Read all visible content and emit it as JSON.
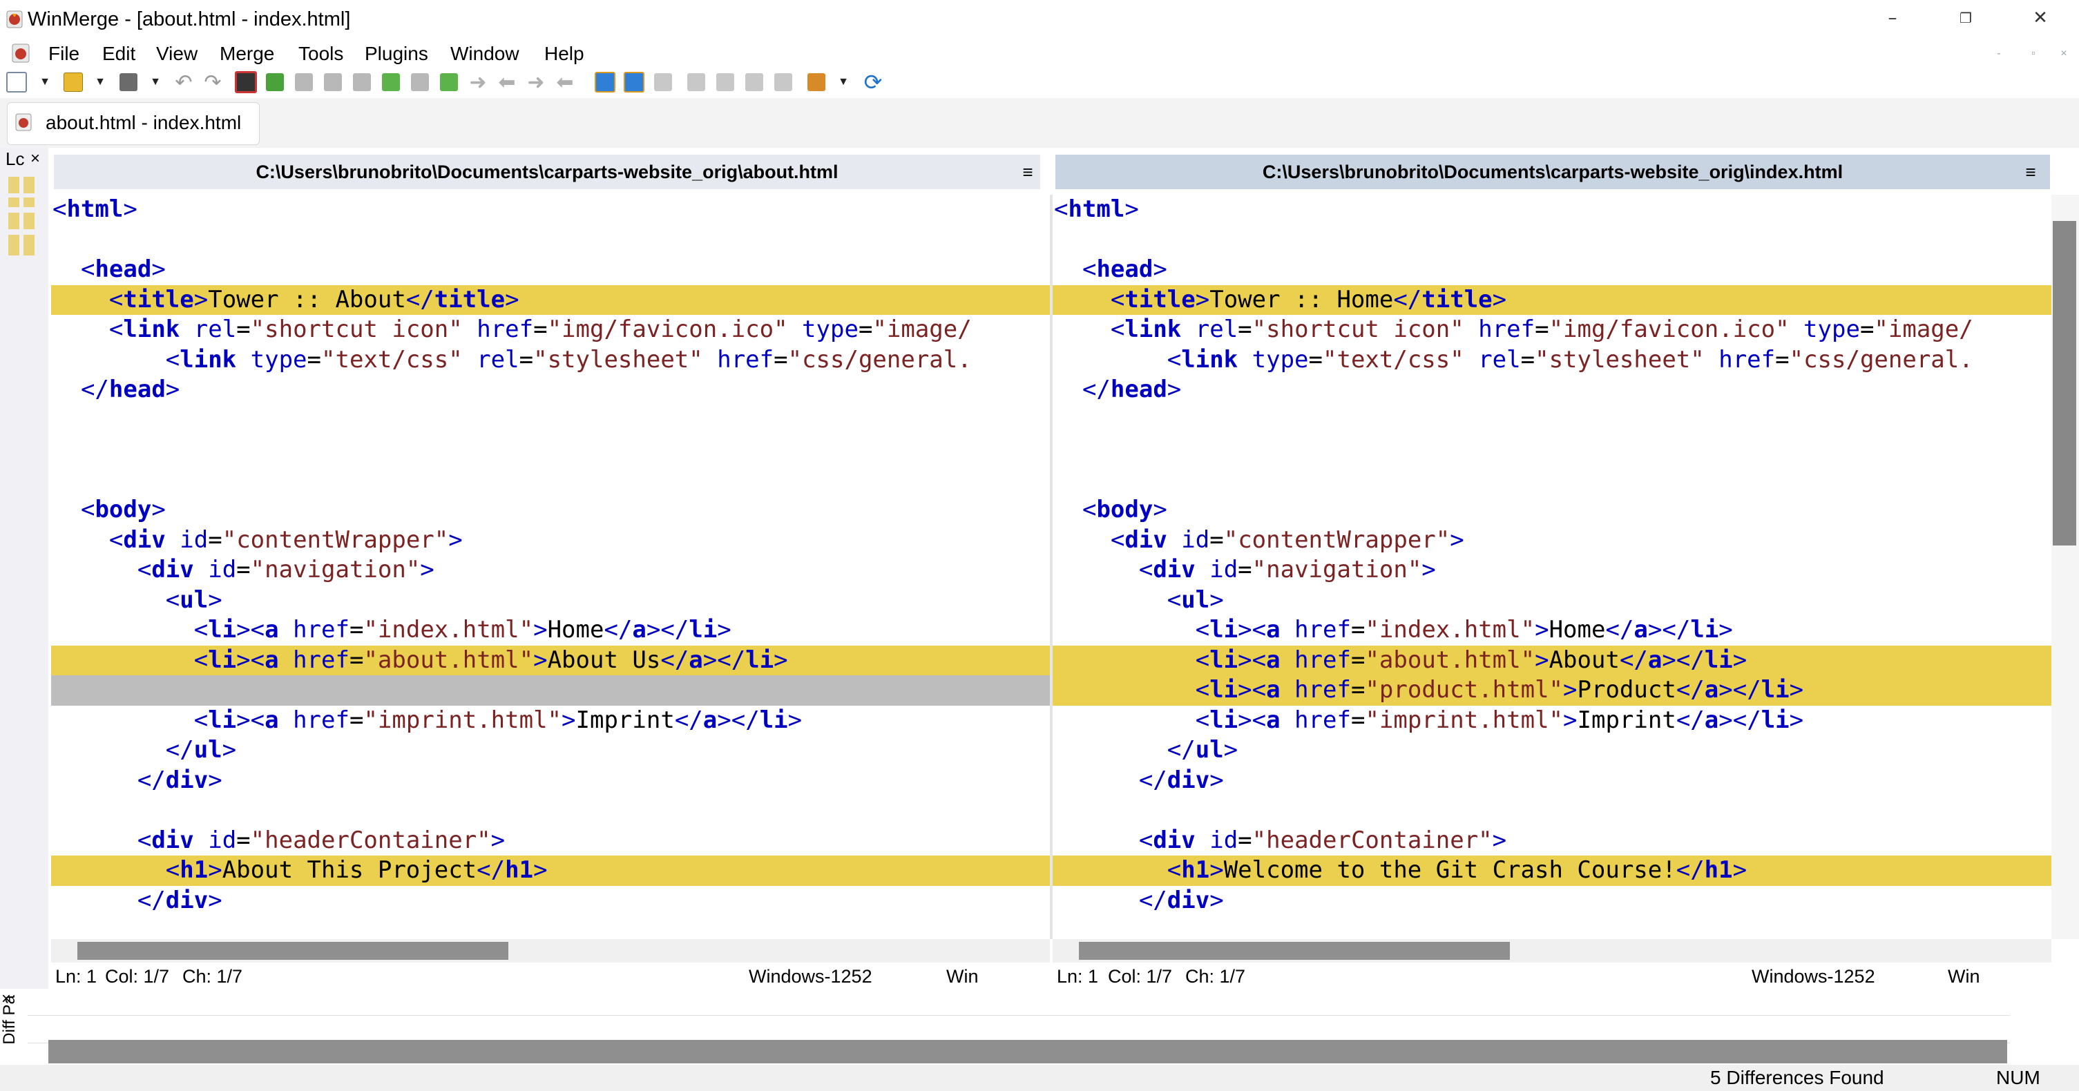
{
  "window": {
    "title": "WinMerge - [about.html - index.html]",
    "minimize_glyph": "–",
    "restore_glyph": "❐",
    "close_glyph": "✕"
  },
  "menu": [
    "File",
    "Edit",
    "View",
    "Merge",
    "Tools",
    "Plugins",
    "Window",
    "Help"
  ],
  "mdi_controls": [
    "-",
    "▫",
    "×"
  ],
  "toolbar_icons": [
    "new-icon",
    "open-folder-icon",
    "save-icon",
    "undo-icon",
    "redo-icon",
    "filter-icon",
    "next-diff-icon",
    "prev-diff-icon",
    "first-diff-icon",
    "last-diff-icon",
    "current-diff-icon",
    "next-conflict-icon",
    "prev-conflict-icon",
    "copy-right-icon",
    "copy-left-icon",
    "copy-right-advance-icon",
    "copy-left-advance-icon",
    "copy-all-right-icon",
    "copy-all-left-icon",
    "merge-icon",
    "compare-icon",
    "first-file-icon",
    "prev-file-icon",
    "next-file-icon",
    "last-file-icon",
    "options-icon",
    "refresh-icon"
  ],
  "tab": {
    "label": "about.html - index.html"
  },
  "location_pane": {
    "title": "Lc",
    "close": "×"
  },
  "left": {
    "path": "C:\\Users\\brunobrito\\Documents\\carparts-website_orig\\about.html",
    "menu_glyph": "≡",
    "status": {
      "ln": "Ln: 1",
      "col": "Col: 1/7",
      "ch": "Ch: 1/7",
      "encoding": "Windows-1252",
      "eol": "Win"
    }
  },
  "right": {
    "path": "C:\\Users\\brunobrito\\Documents\\carparts-website_orig\\index.html",
    "menu_glyph": "≡",
    "status": {
      "ln": "Ln: 1",
      "col": "Col: 1/7",
      "ch": "Ch: 1/7",
      "encoding": "Windows-1252",
      "eol": "Win"
    }
  },
  "code_left": [
    "<html>",
    "",
    "  <head>",
    "    <title>Tower :: About</title>",
    "    <link rel=\"shortcut icon\" href=\"img/favicon.ico\" type=\"image/",
    "        <link type=\"text/css\" rel=\"stylesheet\" href=\"css/general.",
    "  </head>",
    "",
    "",
    "",
    "  <body>",
    "    <div id=\"contentWrapper\">",
    "      <div id=\"navigation\">",
    "        <ul>",
    "          <li><a href=\"index.html\">Home</a></li>",
    "          <li><a href=\"about.html\">About Us</a></li>",
    "",
    "          <li><a href=\"imprint.html\">Imprint</a></li>",
    "        </ul>",
    "      </div>",
    "",
    "      <div id=\"headerContainer\">",
    "        <h1>About This Project</h1>",
    "      </div>"
  ],
  "code_right": [
    "<html>",
    "",
    "  <head>",
    "    <title>Tower :: Home</title>",
    "    <link rel=\"shortcut icon\" href=\"img/favicon.ico\" type=\"image/",
    "        <link type=\"text/css\" rel=\"stylesheet\" href=\"css/general.",
    "  </head>",
    "",
    "",
    "",
    "  <body>",
    "    <div id=\"contentWrapper\">",
    "      <div id=\"navigation\">",
    "        <ul>",
    "          <li><a href=\"index.html\">Home</a></li>",
    "          <li><a href=\"about.html\">About</a></li>",
    "          <li><a href=\"product.html\">Product</a></li>",
    "          <li><a href=\"imprint.html\">Imprint</a></li>",
    "        </ul>",
    "      </div>",
    "",
    "      <div id=\"headerContainer\">",
    "        <h1>Welcome to the Git Crash Course!</h1>",
    "      </div>"
  ],
  "diff_pane": {
    "title": "Diff Pa",
    "close": "×"
  },
  "statusbar": {
    "differences": "5 Differences Found",
    "num": "NUM"
  },
  "colors": {
    "diff_line": "#ead04e",
    "diff_word": "#f7ecbc",
    "diff_word_removed": "#f2a98b",
    "gap_line": "#bdbdbd",
    "tag": "#0000c0",
    "string": "#7b2222"
  }
}
